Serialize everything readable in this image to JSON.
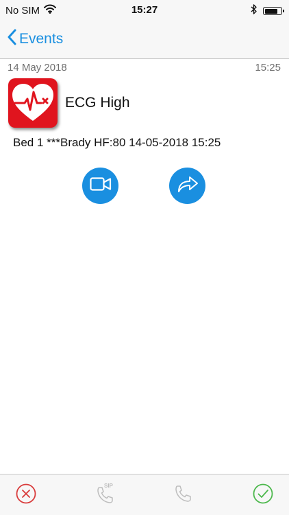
{
  "status_bar": {
    "carrier": "No SIM",
    "time": "15:27",
    "icons": [
      "wifi-icon",
      "bluetooth-icon",
      "battery-icon"
    ]
  },
  "nav": {
    "back_label": "Events"
  },
  "event": {
    "date": "14 May 2018",
    "time": "15:25",
    "title": "ECG High",
    "description": "Bed 1 ***Brady HF:80 14-05-2018 15:25",
    "icon": "heart-ecg-icon"
  },
  "actions": [
    {
      "icon": "video-camera-icon"
    },
    {
      "icon": "forward-icon"
    }
  ],
  "bottom_bar": {
    "items": [
      {
        "icon": "cancel-icon"
      },
      {
        "icon": "sip-call-icon",
        "badge": "SIP"
      },
      {
        "icon": "phone-icon"
      },
      {
        "icon": "confirm-icon"
      }
    ]
  },
  "colors": {
    "accent": "#1a8fe0",
    "alert_red": "#e0141e",
    "cancel_red": "#d93b3b",
    "confirm_green": "#4cb84c",
    "disabled_gray": "#bdbdbd"
  }
}
